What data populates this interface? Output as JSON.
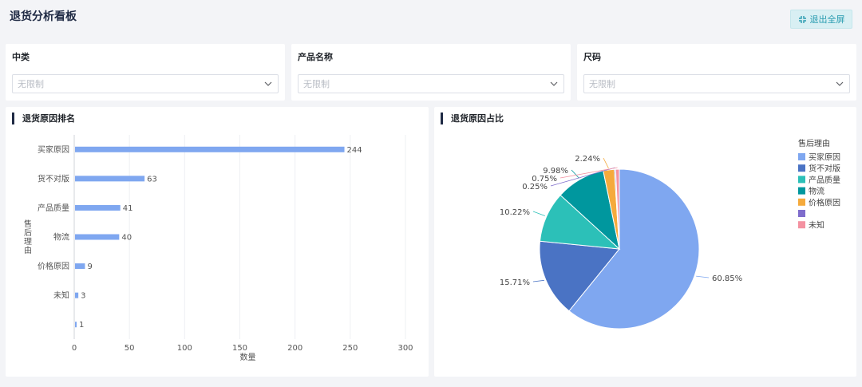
{
  "page": {
    "title": "退货分析看板",
    "fullscreen_label": "退出全屏"
  },
  "filters": [
    {
      "label": "中类",
      "placeholder": "无限制"
    },
    {
      "label": "产品名称",
      "placeholder": "无限制"
    },
    {
      "label": "尺码",
      "placeholder": "无限制"
    }
  ],
  "colors": {
    "accent": "#2a9cb0",
    "title_bar": "#1f2a44"
  },
  "chart_data": [
    {
      "type": "bar",
      "orientation": "horizontal",
      "title": "退货原因排名",
      "xlabel": "数量",
      "ylabel": "售后理由",
      "categories": [
        "买家原因",
        "货不对版",
        "产品质量",
        "物流",
        "价格原因",
        "未知",
        ""
      ],
      "values": [
        244,
        63,
        41,
        40,
        9,
        3,
        1
      ],
      "xlim": [
        0,
        300
      ],
      "xticks": [
        0,
        50,
        100,
        150,
        200,
        250,
        300
      ],
      "bar_color": "#7fa7f0",
      "grid": true
    },
    {
      "type": "pie",
      "title": "退货原因占比",
      "legend_title": "售后理由",
      "legend_position": "right",
      "slices": [
        {
          "name": "买家原因",
          "label": "60.85%",
          "value": 60.85,
          "color": "#7fa7f0"
        },
        {
          "name": "货不对版",
          "label": "15.71%",
          "value": 15.71,
          "color": "#4a73c4"
        },
        {
          "name": "产品质量",
          "label": "10.22%",
          "value": 10.22,
          "color": "#2cc0b8"
        },
        {
          "name": "物流",
          "label": "9.98%",
          "value": 9.98,
          "color": "#00979e"
        },
        {
          "name": "价格原因",
          "label": "2.24%",
          "value": 2.24,
          "color": "#f5aa3c"
        },
        {
          "name": "",
          "label": "0.25%",
          "value": 0.25,
          "color": "#7f6dcc"
        },
        {
          "name": "未知",
          "label": "0.75%",
          "value": 0.75,
          "color": "#f492a1"
        }
      ]
    }
  ]
}
